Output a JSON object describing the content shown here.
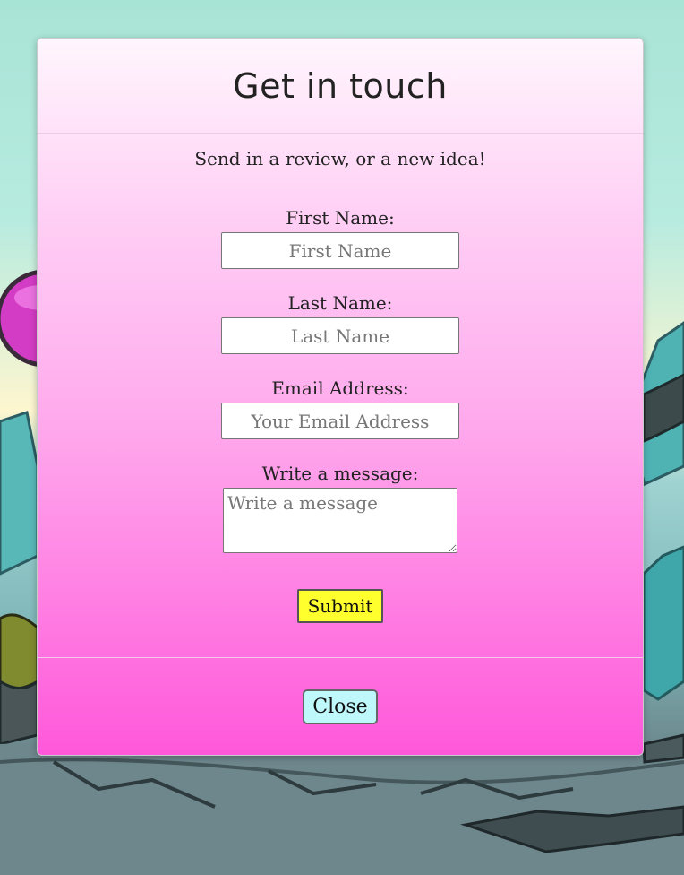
{
  "modal": {
    "title": "Get in touch",
    "subtitle": "Send in a review, or a new idea!"
  },
  "form": {
    "first_name": {
      "label": "First Name:",
      "placeholder": "First Name",
      "value": ""
    },
    "last_name": {
      "label": "Last Name:",
      "placeholder": "Last Name",
      "value": ""
    },
    "email": {
      "label": "Email Address:",
      "placeholder": "Your Email Address",
      "value": ""
    },
    "message": {
      "label": "Write a message:",
      "placeholder": "Write a message",
      "value": ""
    },
    "submit_label": "Submit"
  },
  "footer": {
    "close_label": "Close"
  },
  "colors": {
    "submit_bg": "#ffff2e",
    "close_bg": "#bff8fb",
    "modal_top": "#fff6fd",
    "modal_bottom": "#ff58da"
  }
}
